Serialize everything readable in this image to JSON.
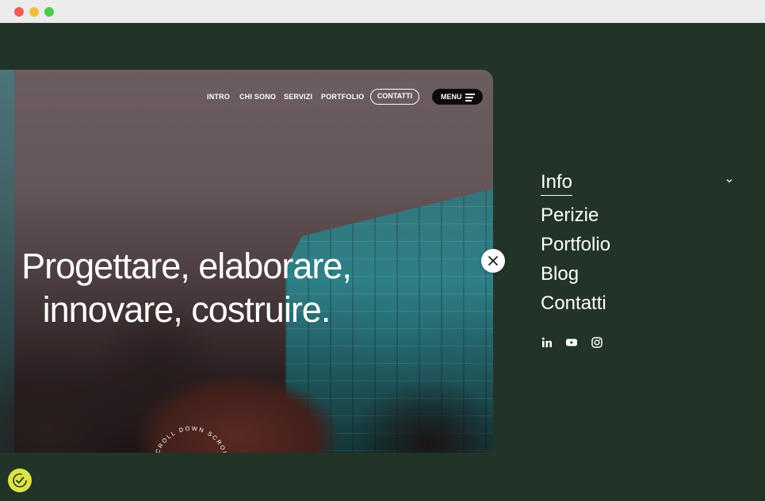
{
  "nav": {
    "links": [
      "INTRO",
      "CHI SONO",
      "SERVIZI",
      "PORTFOLIO"
    ],
    "contact_label": "CONTATTI",
    "menu_label": "MENU"
  },
  "hero": {
    "headline_line1": "Progettare, elaborare,",
    "headline_line2": "innovare, costruire.",
    "scroll_text": "SCROLL DOWN SCROLL DOWN"
  },
  "side_menu": {
    "active": "Info",
    "items": [
      "Perizie",
      "Portfolio",
      "Blog",
      "Contatti"
    ]
  },
  "socials": [
    "linkedin-icon",
    "youtube-icon",
    "instagram-icon"
  ],
  "colors": {
    "background": "#213427",
    "cookie_button": "#dbe34a"
  }
}
